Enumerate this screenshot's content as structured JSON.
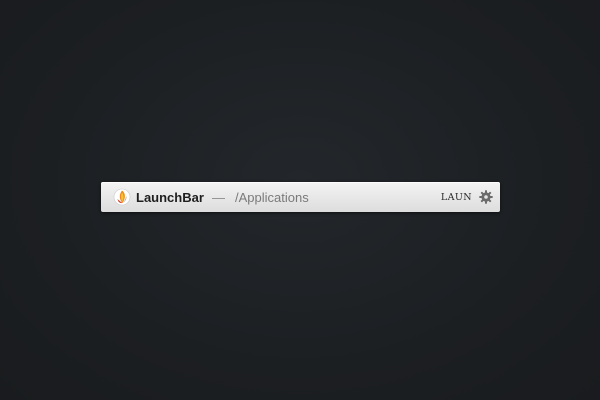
{
  "launchbar": {
    "app_name": "LaunchBar",
    "separator": "—",
    "path": "/Applications",
    "abbreviation": "LAUN",
    "icon": "launchbar-app-icon",
    "settings_icon": "gear-icon"
  },
  "colors": {
    "desktop_background": "#1d2023",
    "bar_background": "#e9e9e9",
    "icon_orange": "#f08a1c",
    "icon_red": "#d9432b",
    "icon_yellow": "#f6c23a"
  }
}
